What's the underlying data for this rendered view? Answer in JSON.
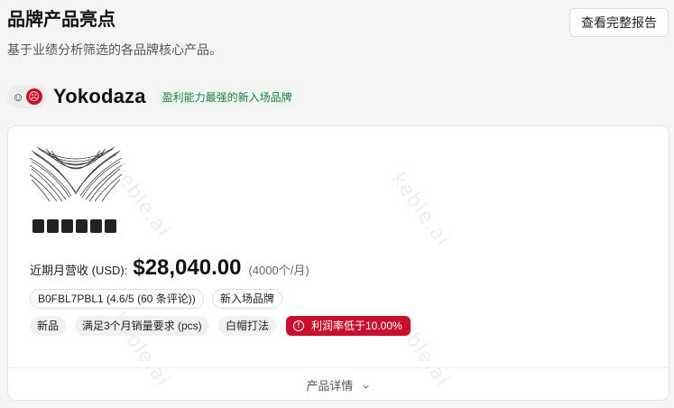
{
  "header": {
    "title": "品牌产品亮点",
    "subtitle": "基于业绩分析筛选的各品牌核心产品。",
    "report_button": "查看完整报告"
  },
  "brand": {
    "logo_icons": [
      "smile-face-icon",
      "brand-logo-circle-icon"
    ],
    "name": "Yokodaza",
    "tag": "盈利能力最强的新入场品牌"
  },
  "product": {
    "image_icon": "hair-extension-product-image",
    "image_caption": "▇▇▇▇▇▇",
    "revenue_label": "近期月营收 (USD):",
    "revenue_value": "$28,040.00",
    "revenue_units": "(4000个/月)",
    "tags_row1": [
      "B0FBL7PBL1 (4.6/5 (60 条评论))",
      "新入场品牌"
    ],
    "tags_row2": [
      "新品",
      "满足3个月销量要求 (pcs)",
      "白帽打法"
    ],
    "alert_tag": "利润率低于10.00%",
    "details_label": "产品详情"
  },
  "watermark": "keble.ai",
  "colors": {
    "accent": "#c8102e",
    "brand_tag_text": "#1f7a4a",
    "brand_tag_bg": "#eef7f1",
    "page_bg": "#f5f5f5"
  }
}
